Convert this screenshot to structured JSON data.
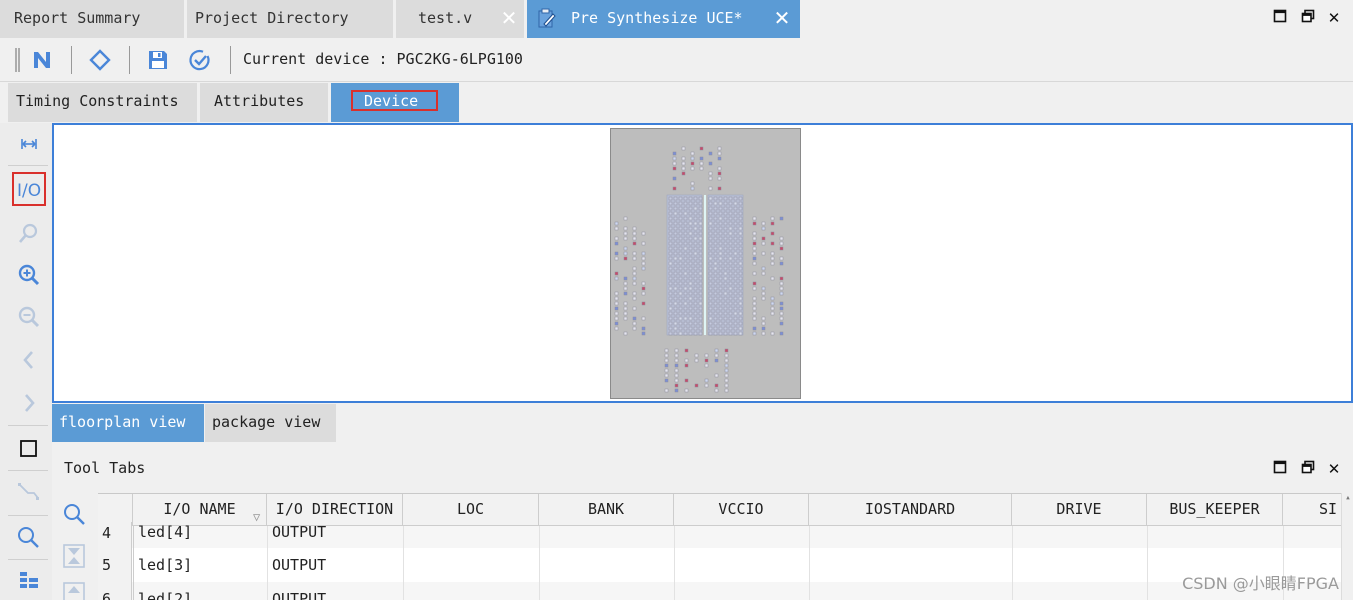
{
  "top_tabs": [
    {
      "label": "Report Summary",
      "active": false
    },
    {
      "label": "Project Directory",
      "active": false
    },
    {
      "label": "test.v",
      "active": false,
      "closable": true
    },
    {
      "label": "Pre Synthesize UCE*",
      "active": true,
      "closable": true,
      "icon": "edit-document-icon"
    }
  ],
  "toolbar": {
    "device_label": "Current device : PGC2KG-6LPG100",
    "icons": [
      "handle-icon",
      "n-logo-icon",
      "diamond-icon",
      "save-icon",
      "check-circle-icon"
    ]
  },
  "sub_tabs": [
    {
      "label": "Timing Constraints",
      "active": false
    },
    {
      "label": "Attributes",
      "active": false
    },
    {
      "label": "Device",
      "active": true
    }
  ],
  "left_tools": [
    "fit-width-icon",
    "io-icon",
    "find-icon",
    "zoom-in-icon",
    "zoom-out-icon",
    "back-icon",
    "forward-icon",
    "select-rect-icon",
    "route-icon",
    "search-icon",
    "table-icon"
  ],
  "view_tabs": [
    {
      "label": "floorplan view",
      "active": true
    },
    {
      "label": "package view",
      "active": false
    }
  ],
  "tool_tabs": {
    "label": "Tool Tabs"
  },
  "table": {
    "columns": [
      "I/O NAME",
      "I/O DIRECTION",
      "LOC",
      "BANK",
      "VCCIO",
      "IOSTANDARD",
      "DRIVE",
      "BUS_KEEPER",
      "SI"
    ],
    "rows": [
      {
        "num": "4",
        "name": "led[4]",
        "direction": "OUTPUT"
      },
      {
        "num": "5",
        "name": "led[3]",
        "direction": "OUTPUT"
      },
      {
        "num": "6",
        "name": "led[2]",
        "direction": "OUTPUT"
      }
    ]
  },
  "watermark": "CSDN @小眼睛FPGA",
  "colors": {
    "accent": "#5b9bd5",
    "canvas_border": "#3d7fd8",
    "highlight_box": "#d9302c"
  }
}
